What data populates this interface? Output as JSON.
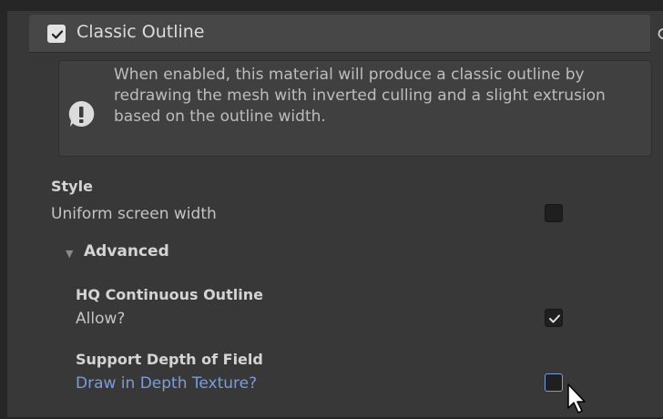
{
  "header": {
    "title": "Classic Outline",
    "enabled": true
  },
  "help": {
    "text": "When enabled, this material will produce a classic outline by redrawing the mesh with inverted culling and a slight extrusion based on the outline width."
  },
  "style_section": {
    "title": "Style",
    "property_label": "Uniform screen width",
    "checked": false
  },
  "advanced": {
    "label": "Advanced",
    "expanded": true,
    "hq": {
      "title": "HQ Continuous Outline",
      "property_label": "Allow?",
      "checked": true
    },
    "dof": {
      "title": "Support Depth of Field",
      "property_label": "Draw in Depth Texture?",
      "checked": false
    }
  },
  "colors": {
    "accent_blue": "#7a9ddb",
    "panel_bg": "#383838",
    "header_bg": "#474747"
  }
}
